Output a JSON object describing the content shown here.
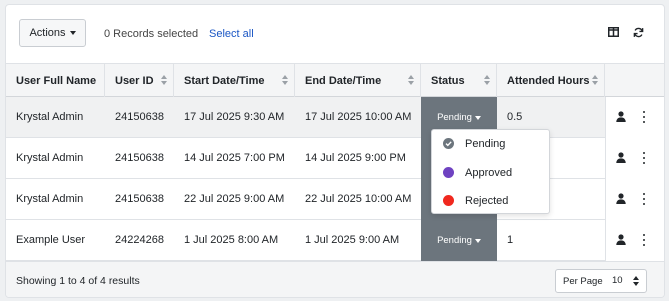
{
  "toolbar": {
    "actions_label": "Actions",
    "records_selected": "0 Records selected",
    "select_all": "Select all",
    "icons": [
      "columns-icon",
      "refresh-icon"
    ]
  },
  "columns": [
    "User Full Name",
    "User ID",
    "Start Date/Time",
    "End Date/Time",
    "Status",
    "Attended Hours"
  ],
  "rows": [
    {
      "name": "Krystal Admin",
      "user_id": "24150638",
      "start": "17 Jul 2025 9:30 AM",
      "end": "17 Jul 2025 10:00 AM",
      "status": "Pending",
      "hours": "0.5"
    },
    {
      "name": "Krystal Admin",
      "user_id": "24150638",
      "start": "14 Jul 2025 7:00 PM",
      "end": "14 Jul 2025 9:00 PM",
      "status": "",
      "hours": ""
    },
    {
      "name": "Krystal Admin",
      "user_id": "24150638",
      "start": "22 Jul 2025 9:00 AM",
      "end": "22 Jul 2025 10:00 AM",
      "status": "",
      "hours": ""
    },
    {
      "name": "Example User",
      "user_id": "24224268",
      "start": "1 Jul 2025 8:00 AM",
      "end": "1 Jul 2025 9:00 AM",
      "status": "Pending",
      "hours": "1"
    }
  ],
  "status_dropdown": {
    "options": [
      {
        "label": "Pending",
        "color": "#6c757d"
      },
      {
        "label": "Approved",
        "color": "#6f42c1"
      },
      {
        "label": "Rejected",
        "color": "#f0281e"
      }
    ]
  },
  "footer": {
    "showing": "Showing 1 to 4 of 4 results",
    "per_page_label": "Per Page",
    "per_page_value": "10"
  },
  "colors": {
    "status_bg": "#6c757d",
    "link": "#1a56c4"
  }
}
